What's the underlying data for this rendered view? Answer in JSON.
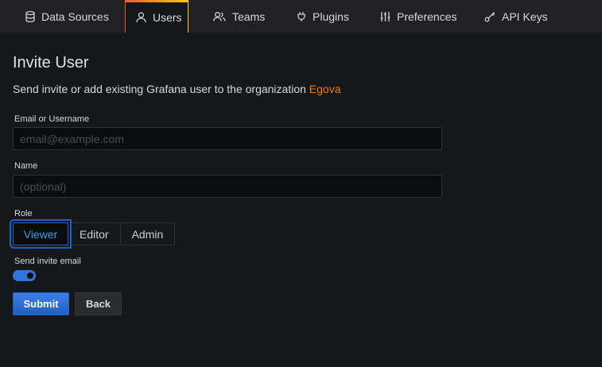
{
  "tabs": [
    {
      "label": "Data Sources",
      "icon": "database-icon",
      "active": false
    },
    {
      "label": "Users",
      "icon": "user-icon",
      "active": true
    },
    {
      "label": "Teams",
      "icon": "users-icon",
      "active": false
    },
    {
      "label": "Plugins",
      "icon": "plug-icon",
      "active": false
    },
    {
      "label": "Preferences",
      "icon": "sliders-icon",
      "active": false
    },
    {
      "label": "API Keys",
      "icon": "key-icon",
      "active": false
    }
  ],
  "page": {
    "title": "Invite User",
    "subtitle": "Send invite or add existing Grafana user to the organization ",
    "org_name": "Egova"
  },
  "form": {
    "email_label": "Email or Username",
    "email_placeholder": "email@example.com",
    "email_value": "",
    "name_label": "Name",
    "name_placeholder": "(optional)",
    "name_value": "",
    "role_label": "Role",
    "roles": [
      "Viewer",
      "Editor",
      "Admin"
    ],
    "selected_role": "Viewer",
    "send_invite_label": "Send invite email",
    "send_invite_enabled": true,
    "submit_label": "Submit",
    "back_label": "Back"
  },
  "colors": {
    "accent": "#3274d9",
    "org_highlight": "#eb7b18",
    "background": "#161719"
  }
}
